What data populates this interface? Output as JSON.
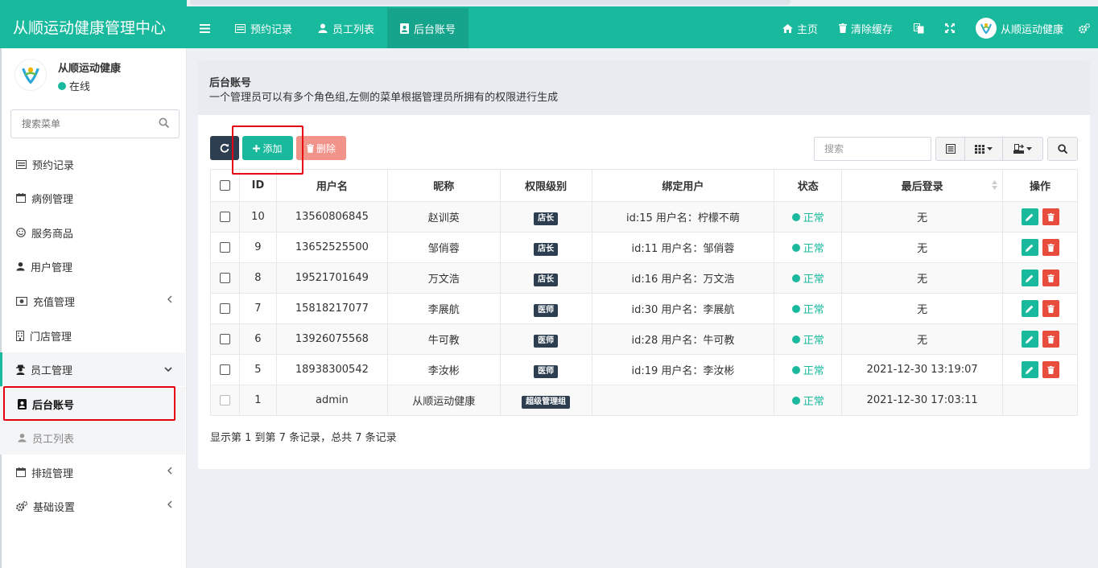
{
  "app": {
    "title": "从顺运动健康管理中心"
  },
  "topnav": {
    "items": [
      {
        "label": "预约记录",
        "icon": "list-icon"
      },
      {
        "label": "员工列表",
        "icon": "user-icon"
      },
      {
        "label": "后台账号",
        "icon": "id-card-icon",
        "active": true
      }
    ],
    "right": {
      "home": "主页",
      "clear_cache": "清除缓存",
      "user_name": "从顺运动健康"
    }
  },
  "sidebar": {
    "user_name": "从顺运动健康",
    "user_status": "在线",
    "search_placeholder": "搜索菜单",
    "items": [
      {
        "label": "预约记录",
        "icon": "list-icon"
      },
      {
        "label": "病例管理",
        "icon": "calendar-icon"
      },
      {
        "label": "服务商品",
        "icon": "smile-icon"
      },
      {
        "label": "用户管理",
        "icon": "user-icon"
      },
      {
        "label": "充值管理",
        "icon": "money-icon",
        "has_children": true
      },
      {
        "label": "门店管理",
        "icon": "building-icon"
      },
      {
        "label": "员工管理",
        "icon": "user-secret-icon",
        "expanded": true
      },
      {
        "label": "排班管理",
        "icon": "calendar-icon",
        "has_children": true
      },
      {
        "label": "基础设置",
        "icon": "gears-icon",
        "has_children": true
      }
    ],
    "subitems": [
      {
        "label": "后台账号",
        "icon": "id-card-icon",
        "active": true
      },
      {
        "label": "员工列表",
        "icon": "user-icon"
      }
    ]
  },
  "page": {
    "title": "后台账号",
    "description": "一个管理员可以有多个角色组,左侧的菜单根据管理员所拥有的权限进行生成"
  },
  "toolbar": {
    "add_label": "添加",
    "delete_label": "删除",
    "search_placeholder": "搜索"
  },
  "table": {
    "headers": [
      "ID",
      "用户名",
      "昵称",
      "权限级别",
      "绑定用户",
      "状态",
      "最后登录",
      "操作"
    ],
    "rows": [
      {
        "id": "10",
        "username": "13560806845",
        "nickname": "赵训英",
        "role": "店长",
        "bound": "id:15 用户名：柠檬不萌",
        "status": "正常",
        "last_login": "无"
      },
      {
        "id": "9",
        "username": "13652525500",
        "nickname": "邹俏蓉",
        "role": "店长",
        "bound": "id:11 用户名：邹俏蓉",
        "status": "正常",
        "last_login": "无"
      },
      {
        "id": "8",
        "username": "19521701649",
        "nickname": "万文浩",
        "role": "店长",
        "bound": "id:16 用户名：万文浩",
        "status": "正常",
        "last_login": "无"
      },
      {
        "id": "7",
        "username": "15818217077",
        "nickname": "李展航",
        "role": "医师",
        "bound": "id:30 用户名：李展航",
        "status": "正常",
        "last_login": "无"
      },
      {
        "id": "6",
        "username": "13926075568",
        "nickname": "牛可教",
        "role": "医师",
        "bound": "id:28 用户名：牛可教",
        "status": "正常",
        "last_login": "无"
      },
      {
        "id": "5",
        "username": "18938300542",
        "nickname": "李汝彬",
        "role": "医师",
        "bound": "id:19 用户名：李汝彬",
        "status": "正常",
        "last_login": "2021-12-30 13:19:07"
      },
      {
        "id": "1",
        "username": "admin",
        "nickname": "从顺运动健康",
        "role": "超级管理组",
        "bound": "",
        "status": "正常",
        "last_login": "2021-12-30 17:03:11"
      }
    ]
  },
  "footer": {
    "summary": "显示第 1 到第 7 条记录，总共 7 条记录"
  },
  "colors": {
    "brand": "#19b99e",
    "dark": "#2c3e50",
    "danger": "#e74c3c",
    "highlight": "#e60012"
  }
}
